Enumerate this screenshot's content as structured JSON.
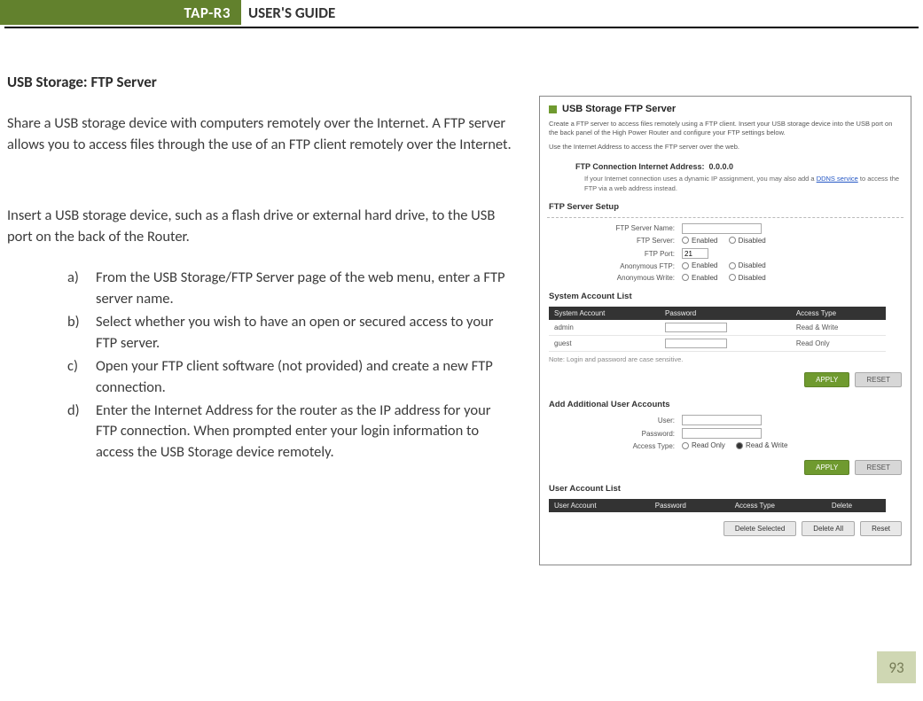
{
  "header": {
    "brand": "TAP-R3",
    "title": "USER'S GUIDE"
  },
  "page_number": "93",
  "doc": {
    "section_title": "USB Storage: FTP Server",
    "para1": "Share a USB storage device with computers remotely over the Internet. A FTP server allows you to access files through the use of an FTP client remotely over the Internet.",
    "para2": "Insert a USB storage device, such as a flash drive or external hard drive, to the USB port on the back of the Router.",
    "steps": [
      {
        "label": "a)",
        "text": "From the USB Storage/FTP Server page of the web menu, enter a FTP server name."
      },
      {
        "label": "b)",
        "text": "Select whether you wish to have an open or secured access to your FTP server."
      },
      {
        "label": "c)",
        "text": "Open your FTP client software (not provided) and create a new FTP connection."
      },
      {
        "label": "d)",
        "text": "Enter the Internet Address for the router as the IP address for your FTP connection.  When prompted enter your login information to access the USB Storage device remotely."
      }
    ]
  },
  "shot": {
    "title": "USB Storage FTP Server",
    "desc1": "Create a FTP server to access files remotely using a FTP client. Insert your USB storage device into the USB port on the back panel of the High Power Router and configure your FTP settings below.",
    "desc2": "Use the Internet Address to access the FTP server over the web.",
    "conn_label": "FTP Connection Internet Address:",
    "conn_value": "0.0.0.0",
    "dyn_note_a": "If your Internet connection uses a dynamic IP assignment, you may also add a ",
    "dyn_link": "DDNS service",
    "dyn_note_b": " to access the FTP via a web address instead.",
    "setup_hdr": "FTP Server Setup",
    "fields": {
      "server_name": {
        "label": "FTP Server Name:",
        "value": ""
      },
      "server_state": {
        "label": "FTP Server:",
        "opt1": "Enabled",
        "opt2": "Disabled"
      },
      "port": {
        "label": "FTP Port:",
        "value": "21"
      },
      "anon_ftp": {
        "label": "Anonymous FTP:",
        "opt1": "Enabled",
        "opt2": "Disabled"
      },
      "anon_write": {
        "label": "Anonymous Write:",
        "opt1": "Enabled",
        "opt2": "Disabled"
      }
    },
    "sys_hdr": "System Account List",
    "sys_cols": {
      "c1": "System Account",
      "c2": "Password",
      "c3": "Access Type"
    },
    "sys_rows": [
      {
        "acct": "admin",
        "pw": "",
        "access": "Read & Write"
      },
      {
        "acct": "guest",
        "pw": "",
        "access": "Read Only"
      }
    ],
    "note": "Note: Login and password are case sensitive.",
    "apply": "APPLY",
    "reset": "RESET",
    "add_hdr": "Add Additional User Accounts",
    "add": {
      "user": {
        "label": "User:",
        "value": ""
      },
      "pw": {
        "label": "Password:",
        "value": ""
      },
      "access": {
        "label": "Access Type:",
        "opt1": "Read Only",
        "opt2": "Read & Write"
      }
    },
    "ual_hdr": "User Account List",
    "ual_cols": {
      "c1": "User Account",
      "c2": "Password",
      "c3": "Access Type",
      "c4": "Delete"
    },
    "footer_btns": {
      "b1": "Delete Selected",
      "b2": "Delete All",
      "b3": "Reset"
    }
  }
}
